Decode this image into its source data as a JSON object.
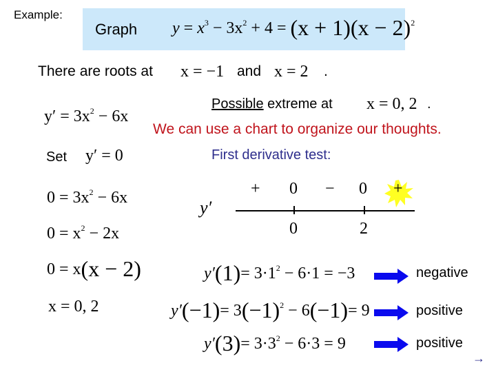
{
  "slide": {
    "example_label": "Example:",
    "header": {
      "graph_label": "Graph",
      "equation": {
        "lhs": "y",
        "eq": "=",
        "term1": "x",
        "term1_exp": "3",
        "term2": "− 3x",
        "term2_exp": "2",
        "term3": "+ 4 =",
        "factor1": "(x + 1)",
        "factor2": "(x − 2)",
        "factor2_exp": "2"
      }
    },
    "roots": {
      "text": "There are roots at",
      "root1": "x = −1",
      "and": "and",
      "root2": "x = 2",
      "period": "."
    },
    "derivative": {
      "lhs": "y′ = 3x",
      "exp": "2",
      "rhs": "− 6x"
    },
    "possible": {
      "underlined": "Possible",
      "text": " extreme at",
      "values": "x = 0,  2",
      "period": "."
    },
    "chart_message": "We can use a chart to organize our thoughts.",
    "first_derivative_label": "First derivative test:",
    "set": {
      "label": "Set",
      "equation": "y′ = 0"
    },
    "steps": [
      {
        "pre": "0 = 3x",
        "exp": "2",
        "post": "− 6x"
      },
      {
        "pre": "0 = x",
        "exp": "2",
        "post": "− 2x"
      },
      {
        "pre": "0 = x",
        "paren": "(x − 2)"
      },
      {
        "pre": "x = 0,  2"
      }
    ],
    "sign_chart": {
      "label": "y′",
      "signs": [
        "+",
        "0",
        "−",
        "0",
        "+"
      ],
      "critical_points": [
        "0",
        "2"
      ],
      "highlight": "starburst-yellow"
    },
    "evaluations": [
      {
        "lhs": "y′",
        "arg": "(1)",
        "rhs_a": "= 3·1",
        "exp": "2",
        "rhs_b": "− 6·1 = −3",
        "result": "negative"
      },
      {
        "lhs": "y′",
        "arg": "(−1)",
        "rhs_a": "= 3",
        "paren": "(−1)",
        "exp": "2",
        "rhs_b": "− 6",
        "paren2": "(−1)",
        "rhs_c": "= 9",
        "result": "positive"
      },
      {
        "lhs": "y′",
        "arg": "(3)",
        "rhs_a": "= 3·3",
        "exp": "2",
        "rhs_b": "− 6·3 = 9",
        "result": "positive"
      }
    ],
    "arrow_icon": "right-block-arrow",
    "next_icon": "→",
    "colors": {
      "header_bg": "#cce8fa",
      "chart_message": "#c0141c",
      "first_derivative": "#2e2e8c",
      "arrow": "#0a0aee",
      "starburst": "#ffff22"
    }
  }
}
